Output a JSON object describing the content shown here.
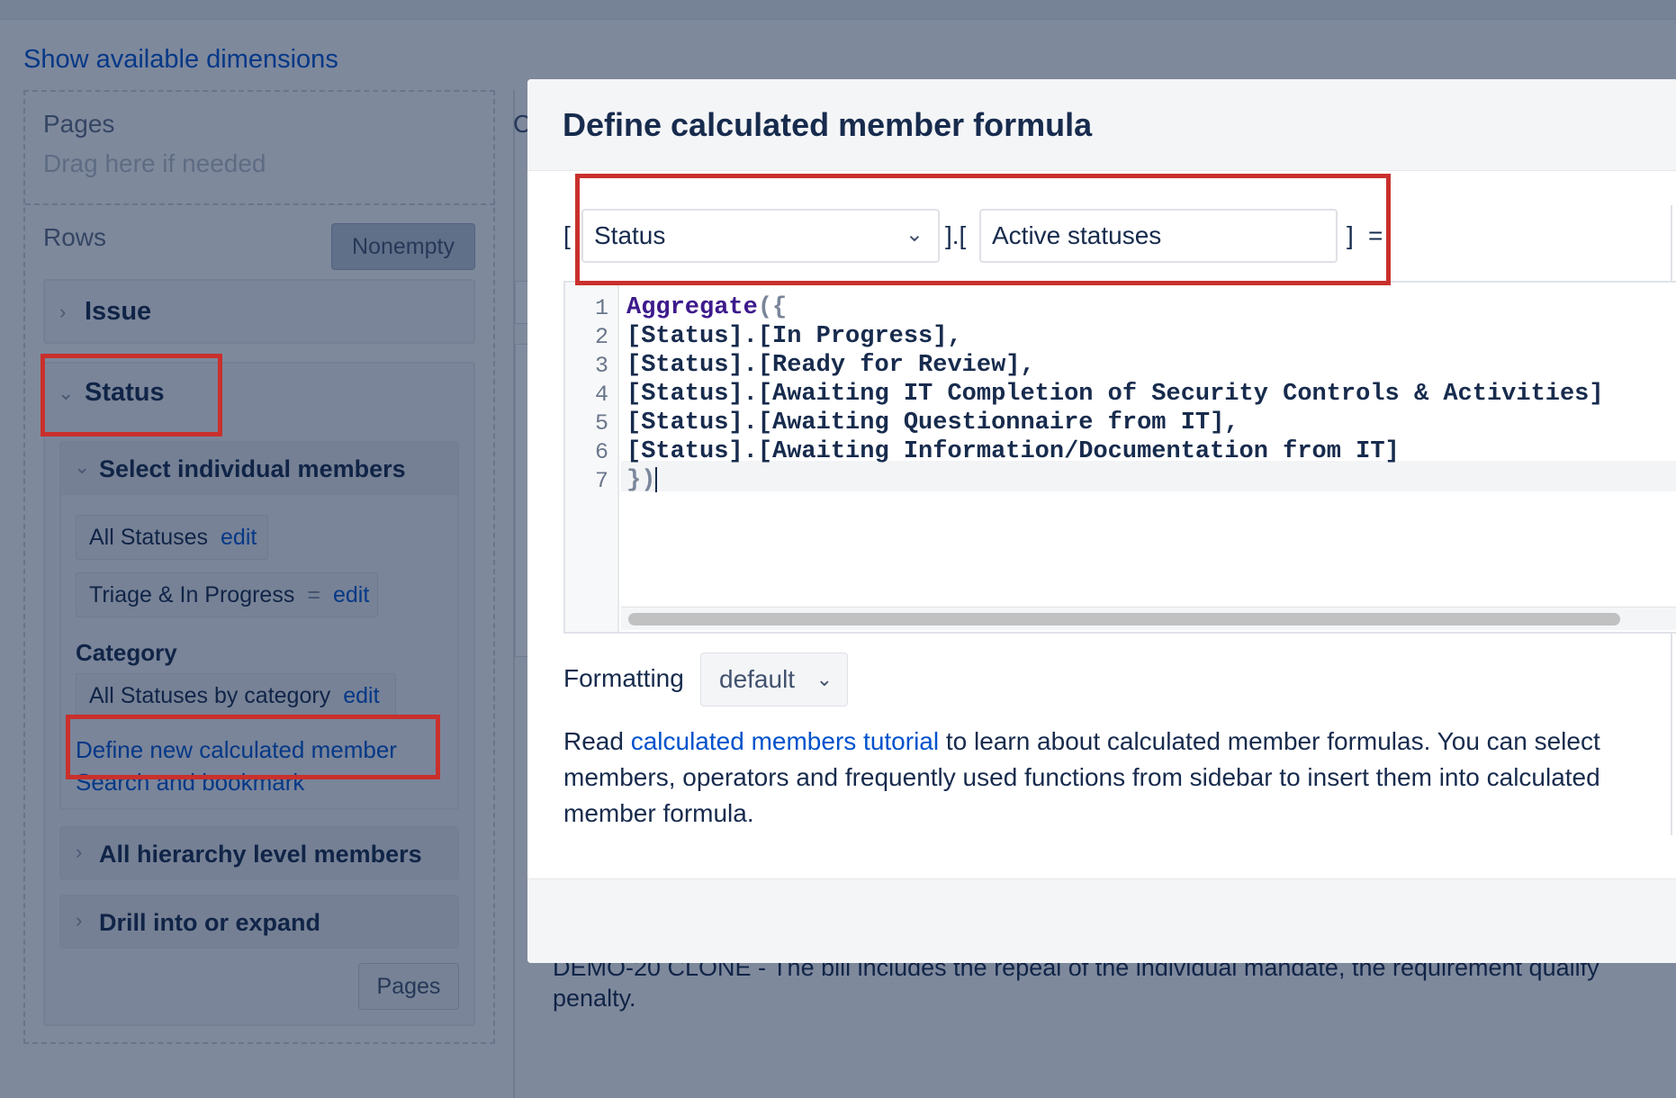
{
  "background": {
    "show_dimensions_link": "Show available dimensions",
    "pages_title": "Pages",
    "pages_placeholder": "Drag here if needed",
    "rows_title": "Rows",
    "nonempty_button": "Nonempty",
    "issue_card_title": "Issue",
    "status_card_title": "Status",
    "select_members_title": "Select individual members",
    "chips": [
      {
        "label": "All Statuses",
        "link": "edit"
      },
      {
        "label": "Triage & In Progress",
        "eq": "=",
        "link": "edit"
      }
    ],
    "category_label": "Category",
    "category_chip": {
      "label": "All Statuses by category",
      "link": "edit"
    },
    "define_calc_link": "Define new calculated member",
    "search_bookmark_link": "Search and bookmark",
    "hierarchy_card_title": "All hierarchy level members",
    "drill_card_title": "Drill into or expand",
    "pages_button": "Pages",
    "right_col_letter": "C",
    "bg_text_line1": "DEMO-20 CLONE - The bill includes the repeal of the individual mandate, the requirement qualify",
    "bg_text_line2": "penalty."
  },
  "modal": {
    "title": "Define calculated member formula",
    "open_bracket": "[",
    "mid_bracket": "].[",
    "close_bracket": "]",
    "equals": "=",
    "dimension_select": "Status",
    "member_name": "Active statuses",
    "editor": {
      "line_numbers": [
        "1",
        "2",
        "3",
        "4",
        "5",
        "6",
        "7"
      ],
      "line1_fn": "Aggregate",
      "line1_rest": "({",
      "line2": "[Status].[In Progress],",
      "line3": "[Status].[Ready for Review],",
      "line4": "[Status].[Awaiting IT Completion of Security Controls & Activities]",
      "line5": "[Status].[Awaiting Questionnaire from IT],",
      "line6": "[Status].[Awaiting Information/Documentation from IT]",
      "line7": "})"
    },
    "formatting_label": "Formatting",
    "formatting_value": "default",
    "desc_pre": "Read ",
    "desc_link": "calculated members tutorial",
    "desc_post": " to learn about calculated member formulas. You can select members, operators and frequently used functions from sidebar to insert them into calculated member formula."
  },
  "colors": {
    "highlight": "#c9302c",
    "link": "#0052cc",
    "overlay": "rgba(9,30,66,0.5)"
  }
}
